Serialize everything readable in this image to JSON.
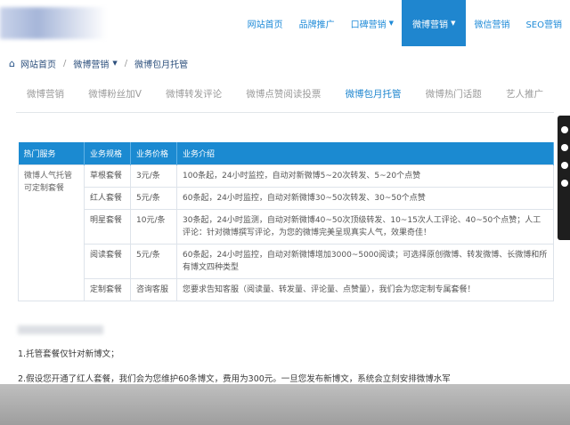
{
  "nav": {
    "items": [
      {
        "label": "网站首页",
        "active": false,
        "caret": false
      },
      {
        "label": "品牌推广",
        "active": false,
        "caret": false
      },
      {
        "label": "口碑营销",
        "active": false,
        "caret": true
      },
      {
        "label": "微博营销",
        "active": true,
        "caret": true
      },
      {
        "label": "微信营销",
        "active": false,
        "caret": false
      },
      {
        "label": "SEO营销",
        "active": false,
        "caret": false
      }
    ],
    "active_color": "#1f86cf"
  },
  "breadcrumb": {
    "home": "网站首页",
    "section": "微博营销",
    "current": "微博包月托管"
  },
  "subtabs": [
    "微博营销",
    "微博粉丝加V",
    "微博转发评论",
    "微博点赞阅读投票",
    "微博包月托管",
    "微博热门话题",
    "艺人推广"
  ],
  "subtabs_active": 4,
  "table": {
    "headers": [
      "热门服务",
      "业务规格",
      "业务价格",
      "业务介绍"
    ],
    "service": "微博人气托管可定制套餐",
    "rows": [
      {
        "spec": "草根套餐",
        "price": "3元/条",
        "desc": "100条起，24小时监控，自动对新微博5~20次转发、5~20个点赞"
      },
      {
        "spec": "红人套餐",
        "price": "5元/条",
        "desc": "60条起，24小时监控，自动对新微博30~50次转发、30~50个点赞"
      },
      {
        "spec": "明星套餐",
        "price": "10元/条",
        "desc": "30条起，24小时监测，自动对新微博40~50次顶级转发、10~15次人工评论、40~50个点赞；人工评论：针对微博撰写评论，为您的微博完美呈现真实人气，效果奇佳！"
      },
      {
        "spec": "阅读套餐",
        "price": "5元/条",
        "desc": "60条起，24小时监控，自动对新微博增加3000~5000阅读；可选择原创微博、转发微博、长微博和所有博文四种类型"
      },
      {
        "spec": "定制套餐",
        "price": "咨询客服",
        "desc": "您要求告知客服（阅读量、转发量、评论量、点赞量），我们会为您定制专属套餐！"
      }
    ]
  },
  "notes": {
    "note1": "1.托管套餐仅针对新博文；",
    "note2": "2.假设您开通了红人套餐，我们会为您维护60条博文，费用为300元。一旦您发布新博文，系统会立刻安排微博水军"
  }
}
